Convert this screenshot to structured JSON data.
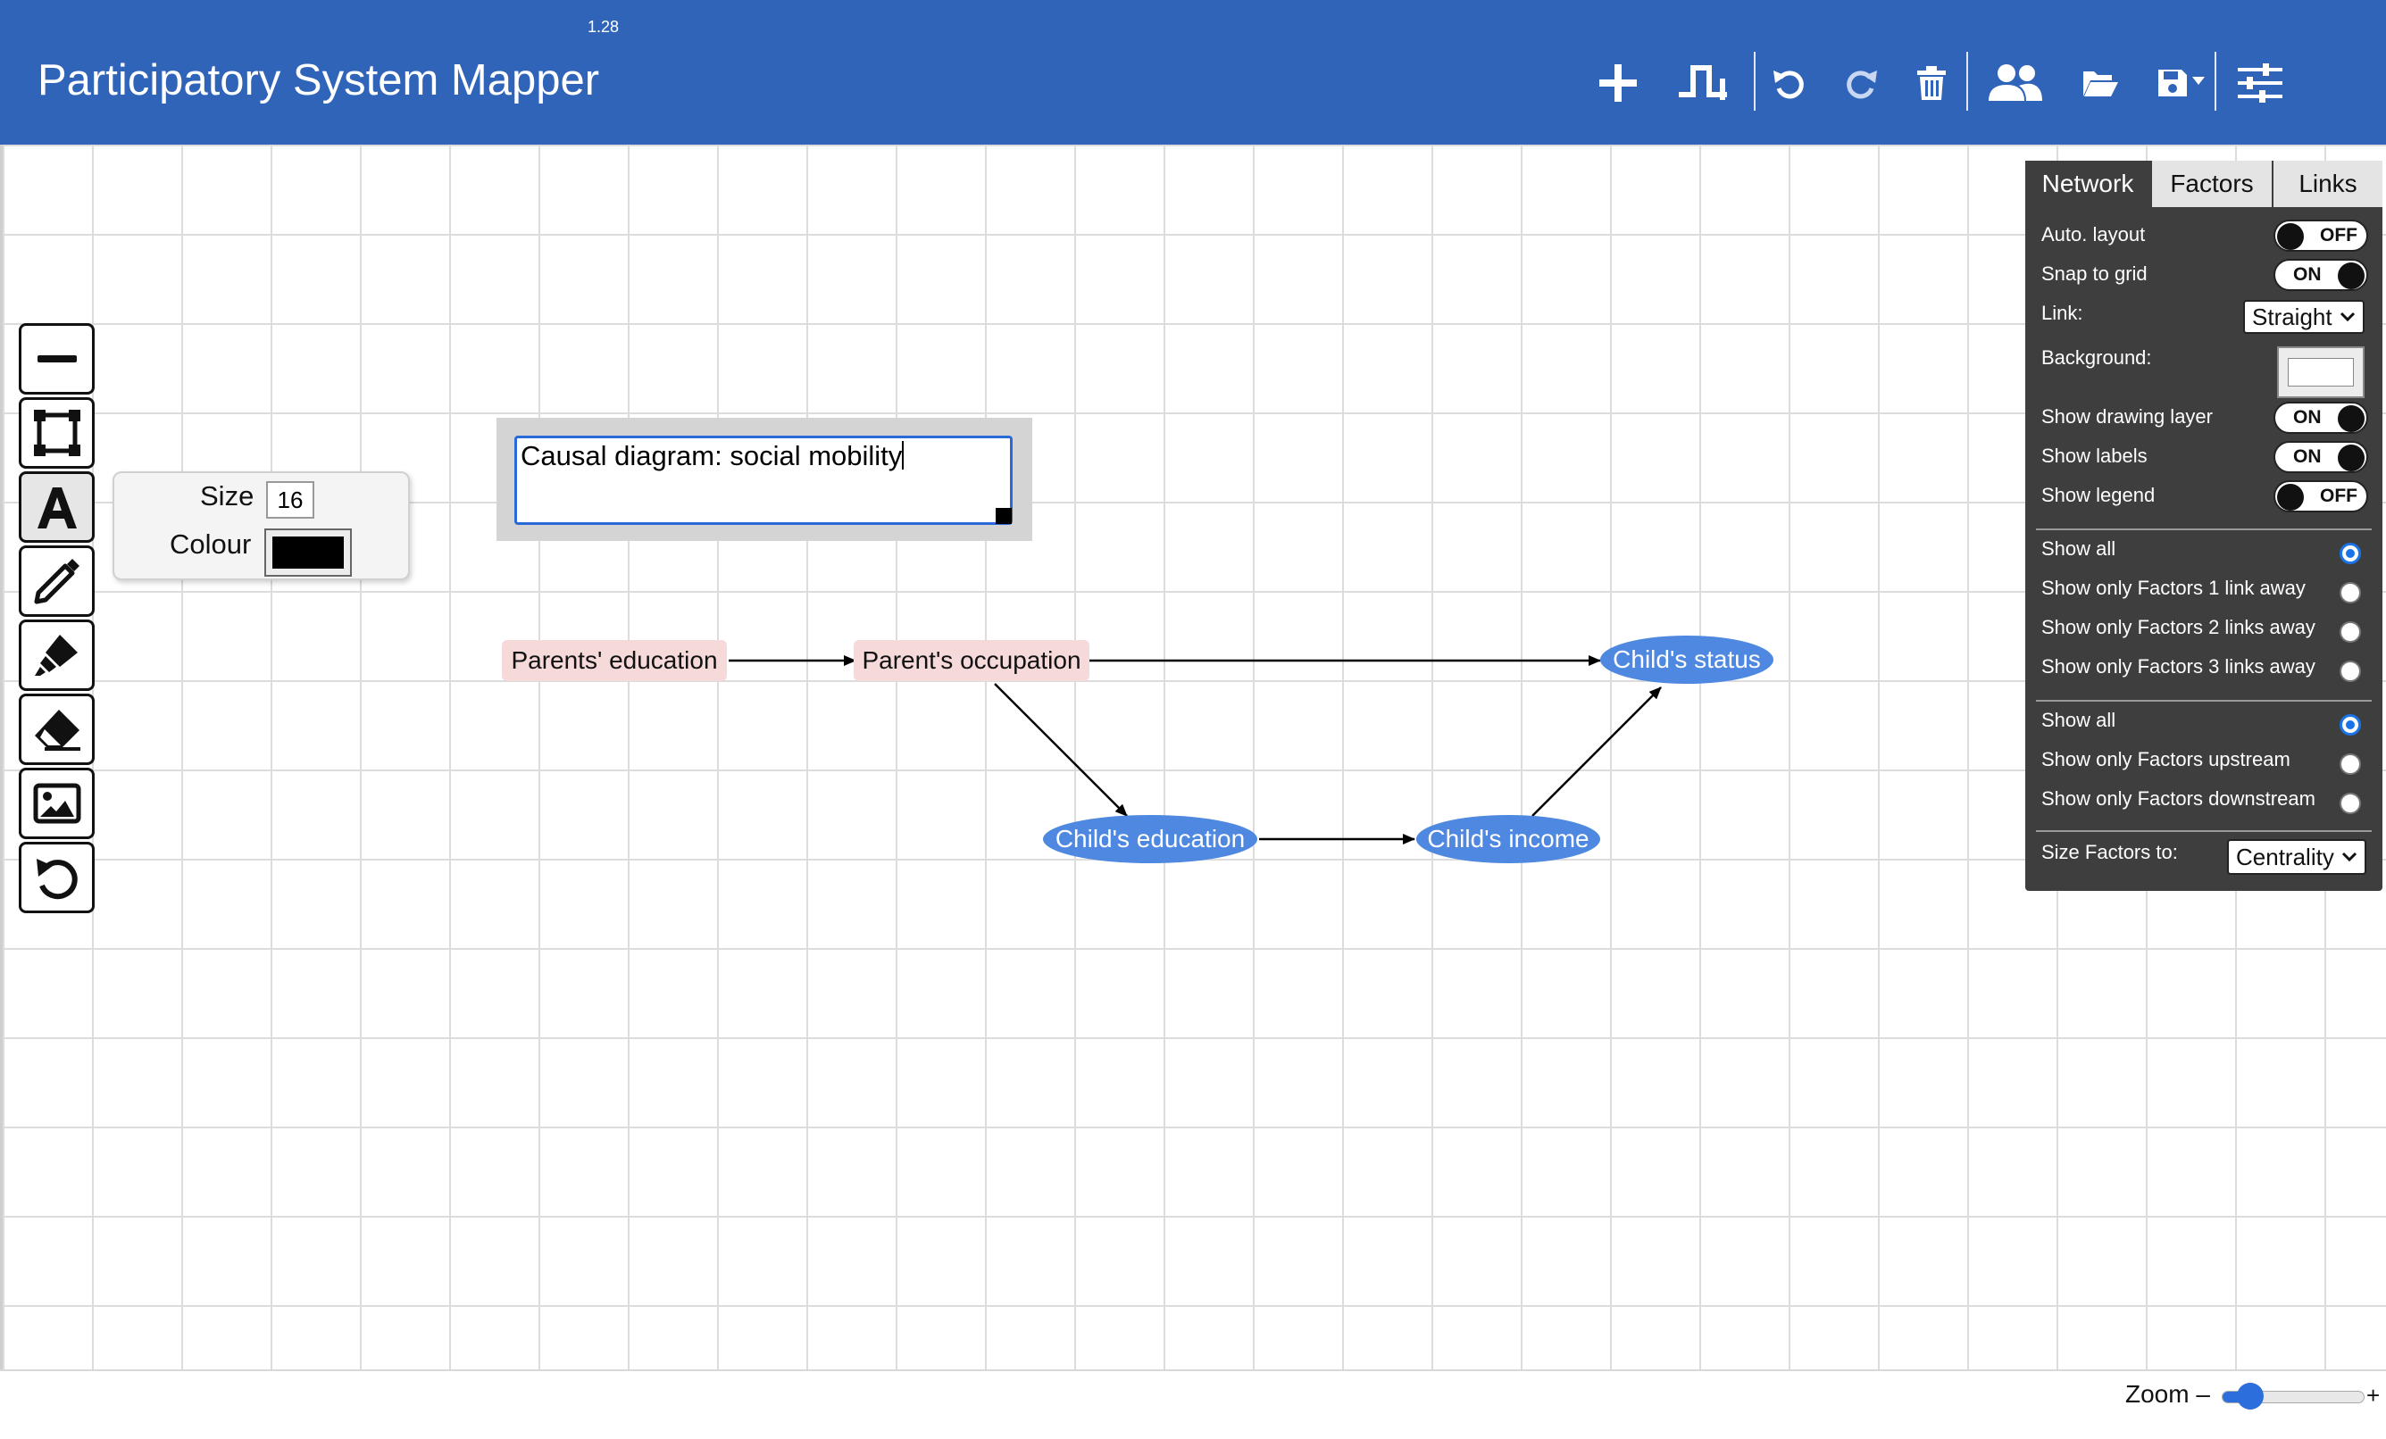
{
  "header": {
    "version": "1.28",
    "title": "Participatory System Mapper",
    "buttons": [
      {
        "name": "add-factor",
        "icon": "plus-icon"
      },
      {
        "name": "add-link",
        "icon": "link-step-icon"
      },
      {
        "name": "undo",
        "icon": "undo-icon"
      },
      {
        "name": "redo",
        "icon": "redo-icon"
      },
      {
        "name": "delete",
        "icon": "trash-icon"
      },
      {
        "name": "share",
        "icon": "users-icon"
      },
      {
        "name": "open",
        "icon": "folder-open-icon"
      },
      {
        "name": "save",
        "icon": "save-dropdown-icon"
      },
      {
        "name": "settings",
        "icon": "sliders-icon"
      }
    ]
  },
  "toolbar": {
    "tools": [
      {
        "name": "line",
        "icon": "line-icon",
        "active": false
      },
      {
        "name": "rectangle",
        "icon": "rectangle-icon",
        "active": false
      },
      {
        "name": "text",
        "icon": "text-icon",
        "active": true
      },
      {
        "name": "pencil",
        "icon": "pencil-icon",
        "active": false
      },
      {
        "name": "marker",
        "icon": "marker-icon",
        "active": false
      },
      {
        "name": "eraser",
        "icon": "eraser-icon",
        "active": false
      },
      {
        "name": "image",
        "icon": "image-icon",
        "active": false
      },
      {
        "name": "undo-drawing",
        "icon": "undo-icon",
        "active": false
      }
    ],
    "text_options": {
      "size_label": "Size",
      "size_value": "16",
      "colour_label": "Colour",
      "colour_value": "#000000"
    }
  },
  "canvas": {
    "text_editor_value": "Causal diagram: social mobility",
    "nodes": [
      {
        "id": "parents-education",
        "label": "Parents' education",
        "shape": "box",
        "color": "#f6d9d9"
      },
      {
        "id": "parents-occupation",
        "label": "Parent's occupation",
        "shape": "box",
        "color": "#f6d9d9"
      },
      {
        "id": "childs-status",
        "label": "Child's status",
        "shape": "ellipse",
        "color": "#4e88e0"
      },
      {
        "id": "childs-education",
        "label": "Child's education",
        "shape": "ellipse",
        "color": "#4e88e0"
      },
      {
        "id": "childs-income",
        "label": "Child's income",
        "shape": "ellipse",
        "color": "#4e88e0"
      }
    ],
    "edges": [
      {
        "from": "parents-education",
        "to": "parents-occupation"
      },
      {
        "from": "parents-occupation",
        "to": "childs-status"
      },
      {
        "from": "parents-occupation",
        "to": "childs-education"
      },
      {
        "from": "childs-education",
        "to": "childs-income"
      },
      {
        "from": "childs-income",
        "to": "childs-status"
      }
    ]
  },
  "panel": {
    "tabs": [
      {
        "label": "Network",
        "active": true
      },
      {
        "label": "Factors",
        "active": false
      },
      {
        "label": "Links",
        "active": false
      }
    ],
    "auto_layout": {
      "label": "Auto. layout",
      "state": "OFF"
    },
    "snap_to_grid": {
      "label": "Snap to grid",
      "state": "ON"
    },
    "link": {
      "label": "Link:",
      "value": "Straight"
    },
    "background": {
      "label": "Background:",
      "color": "#ffffff"
    },
    "show_drawing_layer": {
      "label": "Show drawing layer",
      "state": "ON"
    },
    "show_labels": {
      "label": "Show labels",
      "state": "ON"
    },
    "show_legend": {
      "label": "Show legend",
      "state": "OFF"
    },
    "filter_radius": [
      {
        "label": "Show all",
        "selected": true
      },
      {
        "label": "Show only Factors 1 link away",
        "selected": false
      },
      {
        "label": "Show only Factors 2 links away",
        "selected": false
      },
      {
        "label": "Show only Factors 3 links away",
        "selected": false
      }
    ],
    "filter_direction": [
      {
        "label": "Show all",
        "selected": true
      },
      {
        "label": "Show only Factors upstream",
        "selected": false
      },
      {
        "label": "Show only Factors downstream",
        "selected": false
      }
    ],
    "size_factors": {
      "label": "Size Factors to:",
      "value": "Centrality"
    }
  },
  "zoom": {
    "label": "Zoom –",
    "plus": "+",
    "level": 0.17
  }
}
